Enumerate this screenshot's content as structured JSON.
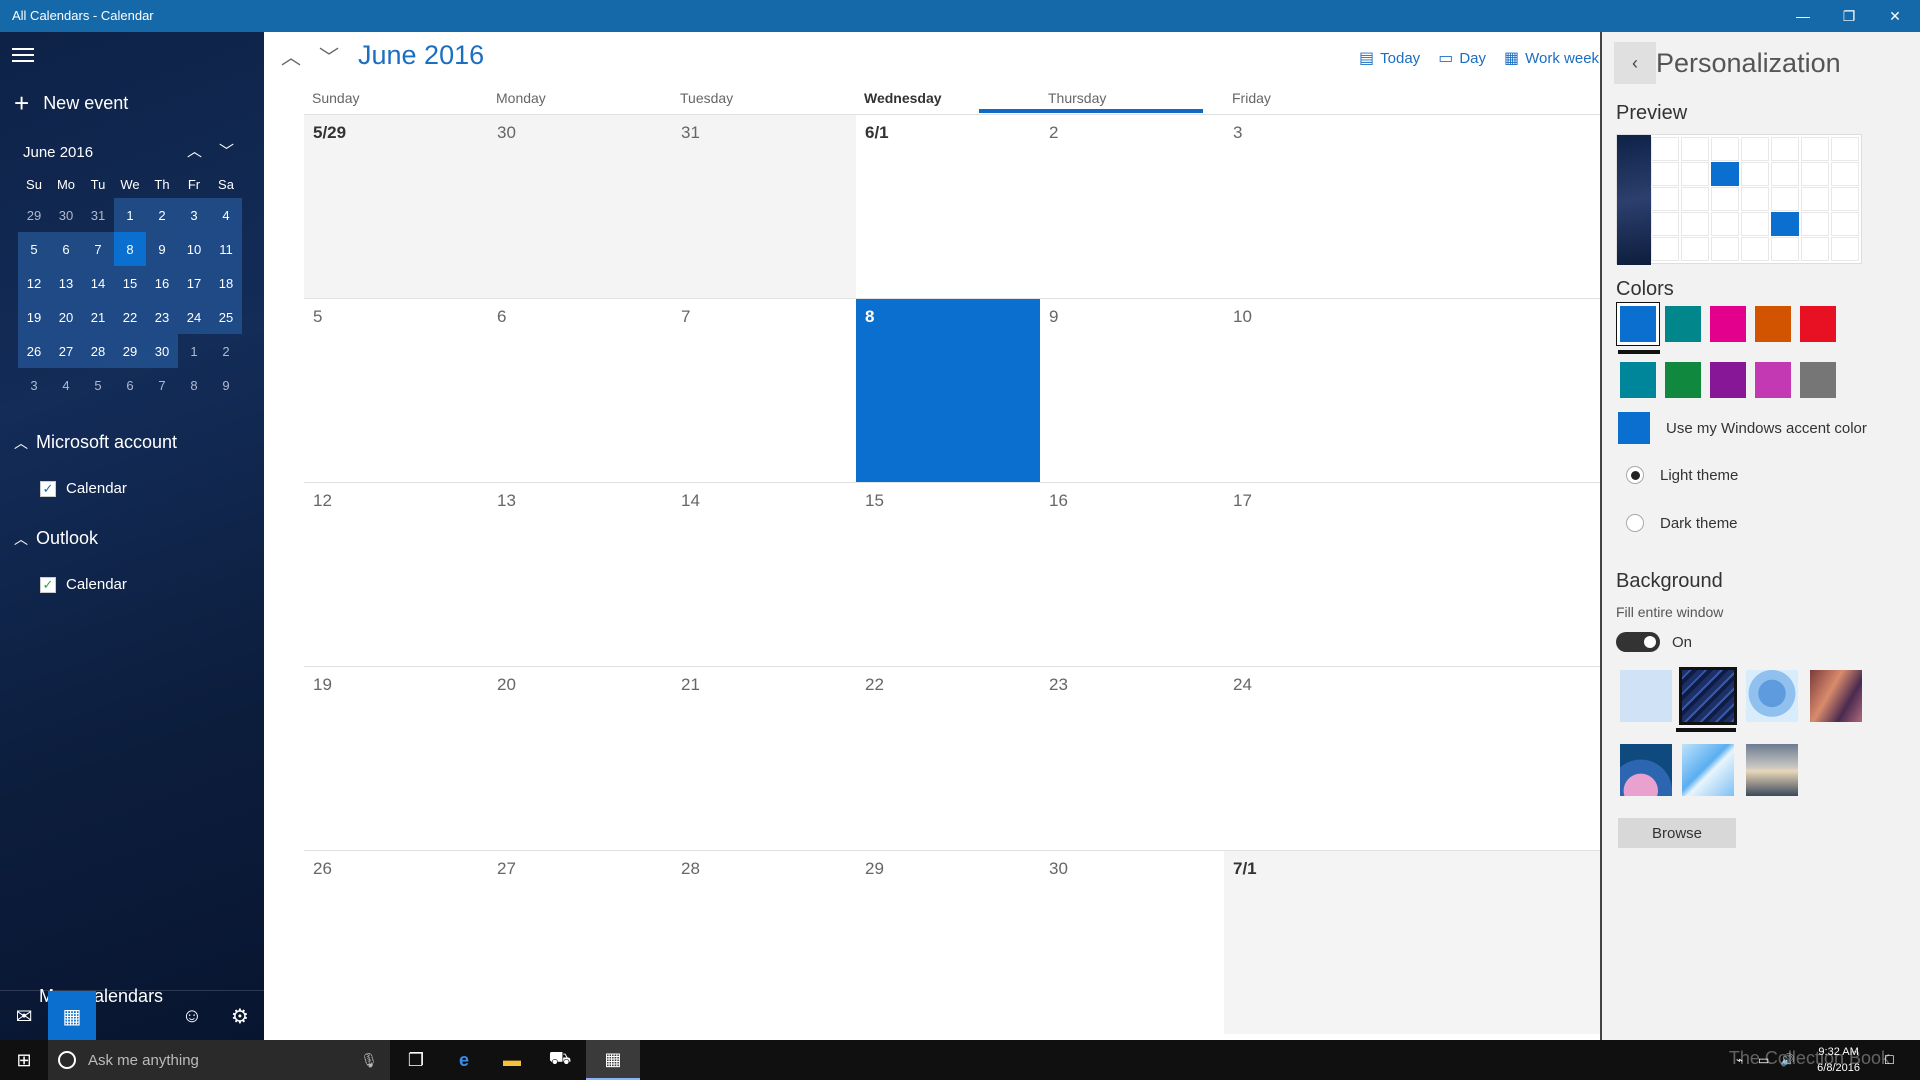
{
  "window": {
    "title": "All Calendars - Calendar",
    "minimize": "—",
    "restore": "❐",
    "close": "✕"
  },
  "sidebar": {
    "new_event": "New event",
    "mini_month": "June 2016",
    "weekdays": [
      "Su",
      "Mo",
      "Tu",
      "We",
      "Th",
      "Fr",
      "Sa"
    ],
    "weeks": [
      [
        "29",
        "30",
        "31",
        "1",
        "2",
        "3",
        "4"
      ],
      [
        "5",
        "6",
        "7",
        "8",
        "9",
        "10",
        "11"
      ],
      [
        "12",
        "13",
        "14",
        "15",
        "16",
        "17",
        "18"
      ],
      [
        "19",
        "20",
        "21",
        "22",
        "23",
        "24",
        "25"
      ],
      [
        "26",
        "27",
        "28",
        "29",
        "30",
        "1",
        "2"
      ],
      [
        "3",
        "4",
        "5",
        "6",
        "7",
        "8",
        "9"
      ]
    ],
    "groups": [
      {
        "name": "Microsoft account",
        "calendar": "Calendar",
        "check_color": "#1569b0"
      },
      {
        "name": "Outlook",
        "calendar": "Calendar",
        "check_color": "#25a94c"
      }
    ],
    "more_calendars": "More calendars",
    "bottom_icons": [
      "mail-icon",
      "calendar-icon",
      "smiley-icon",
      "gear-icon"
    ]
  },
  "main": {
    "month_title": "June 2016",
    "views": [
      "Today",
      "Day",
      "Work week"
    ],
    "day_names": [
      "Sunday",
      "Monday",
      "Tuesday",
      "Wednesday",
      "Thursday",
      "Friday"
    ],
    "weeks": [
      [
        "5/29",
        "30",
        "31",
        "6/1",
        "2",
        "3"
      ],
      [
        "5",
        "6",
        "7",
        "8",
        "9",
        "10"
      ],
      [
        "12",
        "13",
        "14",
        "15",
        "16",
        "17"
      ],
      [
        "19",
        "20",
        "21",
        "22",
        "23",
        "24"
      ],
      [
        "26",
        "27",
        "28",
        "29",
        "30",
        "7/1"
      ]
    ],
    "today_label": "8"
  },
  "panel": {
    "title": "Personalization",
    "preview_label": "Preview",
    "colors_label": "Colors",
    "colors": [
      "#0a6fcf",
      "#00868b",
      "#e3008c",
      "#d35400",
      "#e81123",
      "#00869a",
      "#10893e",
      "#881798",
      "#c239b3",
      "#767676"
    ],
    "accent_label": "Use my Windows accent color",
    "light_theme": "Light theme",
    "dark_theme": "Dark theme",
    "background_label": "Background",
    "fill_label": "Fill entire window",
    "toggle_label": "On",
    "browse": "Browse"
  },
  "taskbar": {
    "search_placeholder": "Ask me anything",
    "time": "9:32 AM",
    "date": "6/8/2016",
    "watermark": "The Collection Book"
  }
}
